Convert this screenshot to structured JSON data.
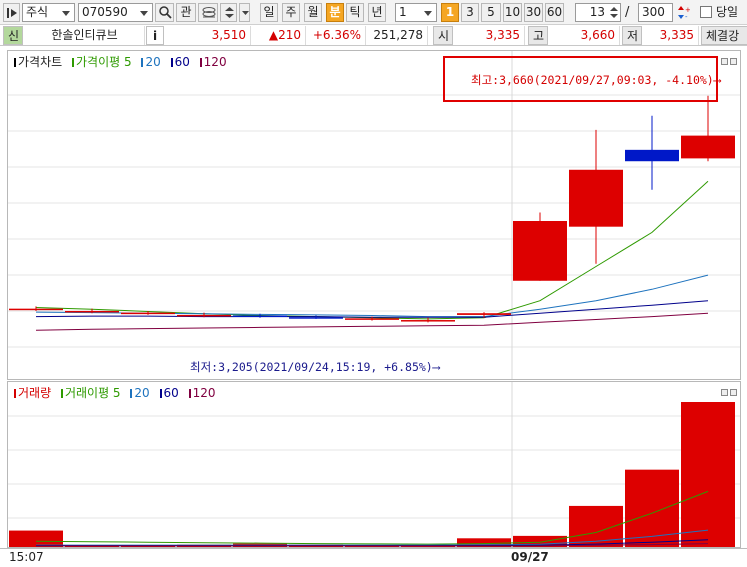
{
  "toolbar": {
    "market": "주식",
    "code": "070590",
    "fav_label": "관",
    "periods": [
      "일",
      "주",
      "월",
      "분",
      "틱",
      "년"
    ],
    "active_period": "분",
    "interval_value": "1",
    "intervals": [
      "1",
      "3",
      "5",
      "10",
      "30",
      "60"
    ],
    "active_interval": "1",
    "count_value": "13",
    "slash": "/",
    "total_value": "300",
    "today_label": "당일"
  },
  "quote": {
    "credit_label": "신",
    "name": "한솔인티큐브",
    "info_label": "i",
    "price": "3,510",
    "change": "▲210",
    "change_pct": "+6.36%",
    "volume": "251,278",
    "open_label": "시",
    "open": "3,335",
    "high_label": "고",
    "high": "3,660",
    "low_label": "저",
    "low": "3,335",
    "trade_label": "체결강"
  },
  "price_legend": [
    {
      "text": "가격차트",
      "color": "#000000"
    },
    {
      "text": "가격이평 5",
      "color": "#2e9a00"
    },
    {
      "text": "20",
      "color": "#1e73be"
    },
    {
      "text": "60",
      "color": "#00008b"
    },
    {
      "text": "120",
      "color": "#800040"
    }
  ],
  "volume_legend": [
    {
      "text": "거래량",
      "color": "#d40000"
    },
    {
      "text": "거래이평 5",
      "color": "#2e9a00"
    },
    {
      "text": "20",
      "color": "#1e73be"
    },
    {
      "text": "60",
      "color": "#00008b"
    },
    {
      "text": "120",
      "color": "#800040"
    }
  ],
  "annotations": {
    "high": "최고:3,660(2021/09/27,09:03, -4.10%)⟶",
    "low": "최저:3,205(2021/09/24,15:19, +6.85%)⟶"
  },
  "x_labels": {
    "left": "15:07",
    "date": "09/27"
  },
  "colors": {
    "up": "#dd0000",
    "down": "#0018c8",
    "grid": "#e4e4e4"
  },
  "chart_data": {
    "type": "candlestick",
    "price_range": [
      3180,
      3700
    ],
    "candles": [
      {
        "o": 3286,
        "h": 3290,
        "l": 3282,
        "c": 3286
      },
      {
        "o": 3282,
        "h": 3286,
        "l": 3278,
        "c": 3282
      },
      {
        "o": 3278,
        "h": 3282,
        "l": 3275,
        "c": 3279
      },
      {
        "o": 3275,
        "h": 3279,
        "l": 3271,
        "c": 3275
      },
      {
        "o": 3274,
        "h": 3277,
        "l": 3270,
        "c": 3273
      },
      {
        "o": 3271,
        "h": 3274,
        "l": 3268,
        "c": 3270
      },
      {
        "o": 3268,
        "h": 3272,
        "l": 3265,
        "c": 3269
      },
      {
        "o": 3266,
        "h": 3270,
        "l": 3262,
        "c": 3266
      },
      {
        "o": 3275,
        "h": 3280,
        "l": 3270,
        "c": 3278
      },
      {
        "o": 3335,
        "h": 3455,
        "l": 3335,
        "c": 3440
      },
      {
        "o": 3430,
        "h": 3600,
        "l": 3365,
        "c": 3530
      },
      {
        "o": 3565,
        "h": 3625,
        "l": 3495,
        "c": 3545
      },
      {
        "o": 3550,
        "h": 3660,
        "l": 3545,
        "c": 3590
      }
    ],
    "ma": [
      {
        "name": "가격이평 5",
        "color": "#2e9a00",
        "values": [
          3288,
          3285,
          3281,
          3277,
          3274,
          3272,
          3270,
          3268,
          3270,
          3300,
          3360,
          3420,
          3510
        ]
      },
      {
        "name": "20",
        "color": "#1e73be",
        "values": [
          3280,
          3279,
          3278,
          3277,
          3276,
          3275,
          3274,
          3272,
          3272,
          3285,
          3300,
          3320,
          3345
        ]
      },
      {
        "name": "60",
        "color": "#00008b",
        "values": [
          3272,
          3273,
          3273,
          3272,
          3272,
          3272,
          3271,
          3271,
          3271,
          3278,
          3285,
          3292,
          3300
        ]
      },
      {
        "name": "120",
        "color": "#800040",
        "values": [
          3248,
          3250,
          3251,
          3252,
          3253,
          3254,
          3255,
          3256,
          3257,
          3262,
          3267,
          3272,
          3278
        ]
      }
    ],
    "volume_range": [
      0,
      30000
    ],
    "volumes": [
      3400,
      400,
      400,
      500,
      700,
      500,
      400,
      300,
      1800,
      2300,
      8500,
      16000,
      30000
    ],
    "volume_ma": [
      {
        "name": "거래이평 5",
        "color": "#2e9a00",
        "values": [
          1200,
          1100,
          1000,
          900,
          800,
          700,
          650,
          600,
          700,
          1000,
          3000,
          7000,
          11500
        ]
      },
      {
        "name": "20",
        "color": "#1e73be",
        "values": [
          400,
          400,
          400,
          400,
          400,
          400,
          400,
          400,
          450,
          550,
          1200,
          2200,
          3500
        ]
      },
      {
        "name": "60",
        "color": "#00008b",
        "values": [
          300,
          300,
          300,
          300,
          300,
          300,
          300,
          300,
          320,
          350,
          600,
          1000,
          1500
        ]
      },
      {
        "name": "120",
        "color": "#800040",
        "values": [
          200,
          200,
          200,
          200,
          200,
          200,
          200,
          200,
          210,
          230,
          350,
          500,
          700
        ]
      }
    ]
  }
}
